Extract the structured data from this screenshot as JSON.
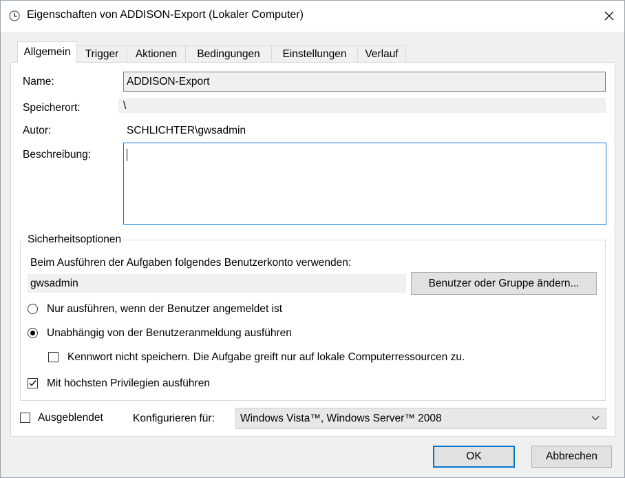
{
  "window": {
    "title": "Eigenschaften von ADDISON-Export (Lokaler Computer)",
    "icon": "clock-icon",
    "close_icon": "close-icon"
  },
  "tabs": [
    {
      "label": "Allgemein",
      "active": true
    },
    {
      "label": "Trigger",
      "active": false
    },
    {
      "label": "Aktionen",
      "active": false
    },
    {
      "label": "Bedingungen",
      "active": false
    },
    {
      "label": "Einstellungen",
      "active": false
    },
    {
      "label": "Verlauf",
      "active": false
    }
  ],
  "general": {
    "name_label": "Name:",
    "name_value": "ADDISON-Export",
    "location_label": "Speicherort:",
    "location_value": "\\",
    "author_label": "Autor:",
    "author_value": "SCHLICHTER\\gwsadmin",
    "description_label": "Beschreibung:",
    "description_value": ""
  },
  "security": {
    "legend": "Sicherheitsoptionen",
    "account_prompt": "Beim Ausführen der Aufgaben folgendes Benutzerkonto verwenden:",
    "account_value": "gwsadmin",
    "change_user_button": "Benutzer oder Gruppe ändern...",
    "radio_logged_on": {
      "label": "Nur ausführen, wenn der Benutzer angemeldet ist",
      "checked": false
    },
    "radio_independent": {
      "label": "Unabhängig von der Benutzeranmeldung ausführen",
      "checked": true
    },
    "no_store_password": {
      "label": "Kennwort nicht speichern. Die Aufgabe greift nur auf lokale Computerressourcen zu.",
      "checked": false
    },
    "highest_privileges": {
      "label": "Mit höchsten Privilegien ausführen",
      "checked": true
    }
  },
  "footer": {
    "hidden": {
      "label": "Ausgeblendet",
      "checked": false
    },
    "configure_label": "Konfigurieren für:",
    "configure_value": "Windows Vista™, Windows Server™ 2008",
    "ok_button": "OK",
    "cancel_button": "Abbrechen"
  },
  "colors": {
    "accent": "#0078d7",
    "dialog_background": "#f0f0f0",
    "panel_background": "#ffffff"
  }
}
